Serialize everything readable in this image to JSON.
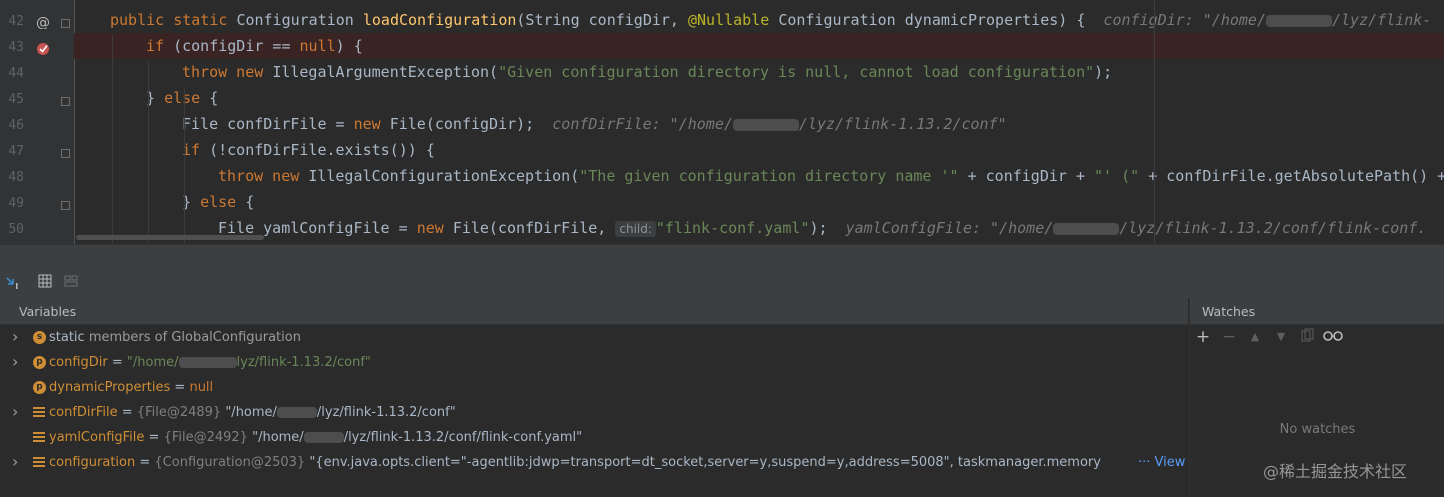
{
  "editor": {
    "line_numbers": [
      "42",
      "43",
      "44",
      "45",
      "46",
      "47",
      "48",
      "49",
      "50"
    ],
    "lines": [
      {
        "parts": [
          [
            "kw",
            "public static "
          ],
          [
            "t",
            "Configuration "
          ],
          [
            "fn",
            "loadConfiguration"
          ],
          [
            "t",
            "(String configDir, "
          ],
          [
            "an",
            "@Nullable "
          ],
          [
            "t",
            "Configuration dynamicProperties) {  "
          ],
          [
            "hint",
            "configDir: \"/home/"
          ],
          [
            "blur",
            ""
          ],
          [
            "hint",
            "/lyz/flink-"
          ]
        ]
      },
      {
        "parts": [
          [
            "kw",
            "if "
          ],
          [
            "t",
            "(configDir == "
          ],
          [
            "kw",
            "null"
          ],
          [
            "t",
            ") {"
          ]
        ]
      },
      {
        "parts": [
          [
            "kw",
            "throw new "
          ],
          [
            "t",
            "IllegalArgumentException("
          ],
          [
            "st",
            "\"Given configuration directory is null, cannot load configuration\""
          ],
          [
            "t",
            ");"
          ]
        ]
      },
      {
        "parts": [
          [
            "t",
            "} "
          ],
          [
            "kw",
            "else "
          ],
          [
            "t",
            "{"
          ]
        ]
      },
      {
        "parts": [
          [
            "t",
            "File confDirFile = "
          ],
          [
            "kw",
            "new "
          ],
          [
            "t",
            "File(configDir);  "
          ],
          [
            "hint",
            "confDirFile: \"/home/"
          ],
          [
            "blur",
            ""
          ],
          [
            "hint",
            "/lyz/flink-1.13.2/conf\""
          ]
        ]
      },
      {
        "parts": [
          [
            "kw",
            "if "
          ],
          [
            "t",
            "(!confDirFile.exists()) {"
          ]
        ]
      },
      {
        "parts": [
          [
            "kw",
            "throw new "
          ],
          [
            "t",
            "IllegalConfigurationException("
          ],
          [
            "st",
            "\"The given configuration directory name '\""
          ],
          [
            "t",
            " + configDir + "
          ],
          [
            "st",
            "\"' (\""
          ],
          [
            "t",
            " + confDirFile.getAbsolutePath() +"
          ]
        ]
      },
      {
        "parts": [
          [
            "t",
            "} "
          ],
          [
            "kw",
            "else "
          ],
          [
            "t",
            "{"
          ]
        ]
      },
      {
        "parts": [
          [
            "t",
            "File yamlConfigFile = "
          ],
          [
            "kw",
            "new "
          ],
          [
            "t",
            "File(confDirFile, "
          ],
          [
            "inlay",
            "child:"
          ],
          [
            "st",
            "\"flink-conf.yaml\""
          ],
          [
            "t",
            ");  "
          ],
          [
            "hint",
            "yamlConfigFile: \"/home/"
          ],
          [
            "blur",
            ""
          ],
          [
            "hint",
            "/lyz/flink-1.13.2/conf/flink-conf."
          ]
        ]
      }
    ]
  },
  "debugger": {
    "variables_title": "Variables",
    "watches_title": "Watches",
    "no_watches": "No watches",
    "variables": [
      {
        "icon": "s",
        "name": "static",
        "rest": " members of GlobalConfiguration",
        "expand": true,
        "static": true
      },
      {
        "icon": "p",
        "name": "configDir",
        "eq": " = ",
        "str": "\"/home/",
        "blur": true,
        "str2": "lyz/flink-1.13.2/conf\"",
        "expand": true
      },
      {
        "icon": "p",
        "name": "dynamicProperties",
        "eq": " = ",
        "null": "null",
        "expand": false
      },
      {
        "icon": "f",
        "name": "confDirFile",
        "eq": " = ",
        "obj": "{File@2489} ",
        "val": "\"/home/",
        "blur": true,
        "val2": "/lyz/flink-1.13.2/conf\"",
        "expand": true
      },
      {
        "icon": "f",
        "name": "yamlConfigFile",
        "eq": " = ",
        "obj": "{File@2492} ",
        "val": "\"/home/",
        "blur": true,
        "val2": "/lyz/flink-1.13.2/conf/flink-conf.yaml\"",
        "expand": false
      },
      {
        "icon": "f",
        "name": "configuration",
        "eq": " = ",
        "obj": "{Configuration@2503} ",
        "val": "\"{env.java.opts.client=\"-agentlib:jdwp=transport=dt_socket,server=y,suspend=y,address=5008\", taskmanager.memory",
        "expand": true,
        "view": true
      }
    ],
    "view_label": "··· View"
  },
  "watermark": "@稀土掘金技术社区",
  "colors": {
    "keyword": "#cc7832",
    "method": "#ffc66d",
    "string": "#6a8759",
    "annotation": "#bbb529",
    "text": "#a9b7c6",
    "breakpoint": "#c75450"
  }
}
